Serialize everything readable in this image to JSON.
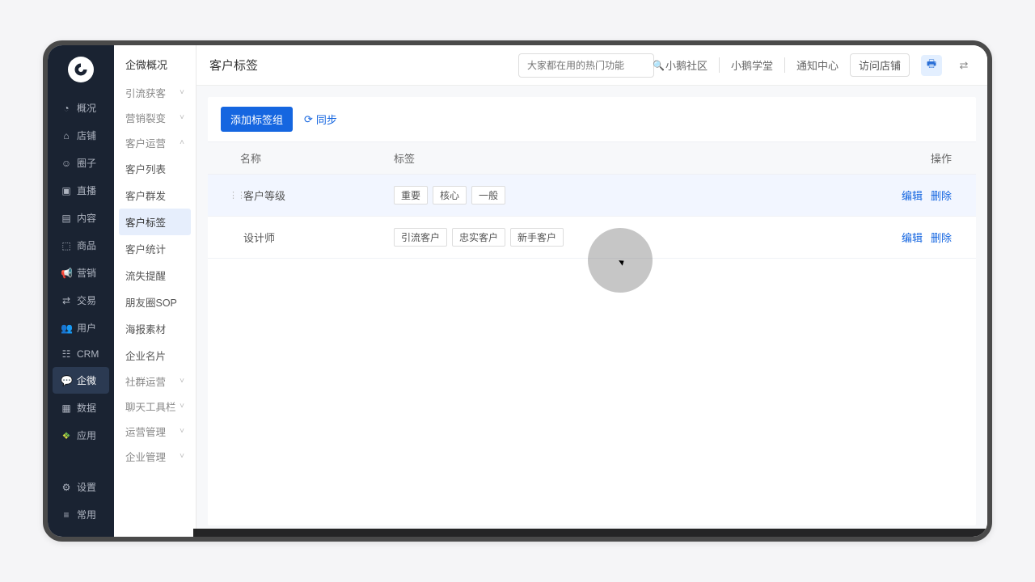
{
  "page": {
    "title": "客户标签"
  },
  "topbar": {
    "search_placeholder": "大家都在用的热门功能",
    "links": {
      "community": "小鹅社区",
      "academy": "小鹅学堂",
      "notify": "通知中心"
    },
    "visit_btn": "访问店铺"
  },
  "navrail": {
    "items": [
      {
        "icon": "◔",
        "label": "概况"
      },
      {
        "icon": "⌂",
        "label": "店铺"
      },
      {
        "icon": "☺",
        "label": "圈子"
      },
      {
        "icon": "▣",
        "label": "直播"
      },
      {
        "icon": "▤",
        "label": "内容"
      },
      {
        "icon": "⬚",
        "label": "商品"
      },
      {
        "icon": "📢",
        "label": "营销"
      },
      {
        "icon": "⇄",
        "label": "交易"
      },
      {
        "icon": "👥",
        "label": "用户"
      },
      {
        "icon": "☷",
        "label": "CRM"
      },
      {
        "icon": "💬",
        "label": "企微",
        "active": true
      },
      {
        "icon": "▦",
        "label": "数据"
      },
      {
        "icon": "❖",
        "label": "应用",
        "colorful": true
      }
    ],
    "bottom": [
      {
        "icon": "⚙",
        "label": "设置"
      },
      {
        "icon": "≡",
        "label": "常用"
      }
    ]
  },
  "subnav": {
    "title": "企微概况",
    "groups": [
      {
        "label": "引流获客",
        "open": false
      },
      {
        "label": "营销裂变",
        "open": false
      },
      {
        "label": "客户运营",
        "open": true,
        "items": [
          "客户列表",
          "客户群发",
          "客户标签",
          "客户统计",
          "流失提醒",
          "朋友圈SOP",
          "海报素材",
          "企业名片"
        ],
        "active": "客户标签"
      },
      {
        "label": "社群运营",
        "open": false
      },
      {
        "label": "聊天工具栏",
        "open": false
      },
      {
        "label": "运营管理",
        "open": false
      },
      {
        "label": "企业管理",
        "open": false
      }
    ]
  },
  "toolbar": {
    "add_group": "添加标签组",
    "sync": "同步"
  },
  "table": {
    "headers": {
      "name": "名称",
      "tags": "标签",
      "ops": "操作"
    },
    "rows": [
      {
        "name": "客户等级",
        "tags": [
          "重要",
          "核心",
          "一般"
        ],
        "hover": true
      },
      {
        "name": "设计师",
        "tags": [
          "引流客户",
          "忠实客户",
          "新手客户"
        ],
        "hover": false
      }
    ],
    "ops": {
      "edit": "编辑",
      "delete": "删除"
    }
  }
}
